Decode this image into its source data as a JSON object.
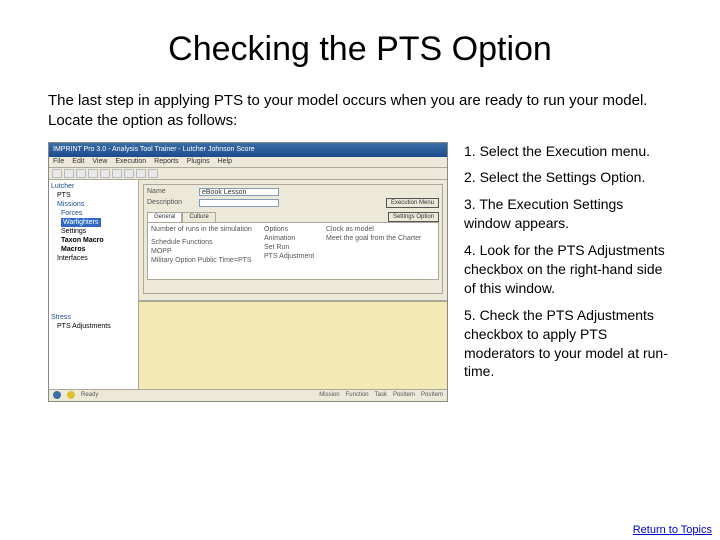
{
  "title": "Checking the PTS Option",
  "intro": "The last step in applying PTS to your model occurs when you are ready to run your model.  Locate the option as follows:",
  "steps": {
    "s1": "1. Select the Execution menu.",
    "s2": "2.  Select the Settings Option.",
    "s3": "3.  The Execution Settings window appears.",
    "s4": "4.  Look for the PTS Adjustments checkbox on the right-hand side of this window.",
    "s5": "5.  Check the PTS Adjustments checkbox to apply PTS moderators to your model at run-time."
  },
  "return_link": "Return to Topics",
  "screenshot": {
    "window_title": "IMPRINT Pro 3.0 - Analysis Tool  Trainer - Lutcher Johnson Score",
    "menu_items": [
      "File",
      "Edit",
      "View",
      "Execution",
      "Reports",
      "Plugins",
      "Help"
    ],
    "tree": {
      "root": "Lutcher",
      "items": [
        "PTS",
        "Missions",
        "Forces",
        "Warfighters",
        "Settings",
        "Taxon Macro",
        "Macros",
        "Interfaces"
      ],
      "highlight": "Warfighters",
      "footer": [
        "Stress",
        "PTS Adjustments"
      ]
    },
    "dialog": {
      "row_labels": [
        "Name",
        "Description"
      ],
      "field1": "eBook Lesson",
      "callouts": [
        "Execution Menu",
        "Settings Option"
      ],
      "tabs": [
        "General",
        "Culture"
      ],
      "group": {
        "left": [
          "Number of runs in the simulation",
          "",
          ""
        ],
        "mid": [
          "Options",
          "Animation",
          "Set Run",
          "PTS Adjustment"
        ],
        "right": [
          "Clock as model",
          "Meet the goal from the Charter",
          "",
          ""
        ],
        "lower": [
          "Schedule Functions",
          "MOPP",
          "Military Option   Public Time=PTS"
        ]
      }
    },
    "status": [
      "Ready",
      "Mission",
      "Function",
      "Task",
      "PosItem",
      "PosItem"
    ]
  }
}
